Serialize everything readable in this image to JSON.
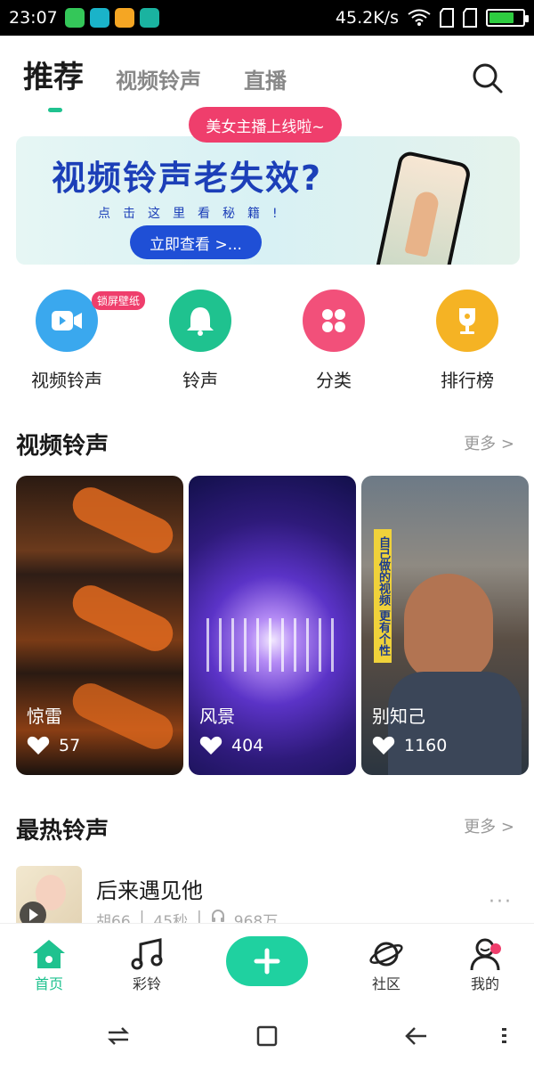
{
  "status": {
    "time": "23:07",
    "speed": "45.2K/s"
  },
  "tabs": [
    {
      "label": "推荐",
      "active": true
    },
    {
      "label": "视频铃声",
      "active": false
    },
    {
      "label": "直播",
      "active": false
    }
  ],
  "live_bubble": "美女主播上线啦~",
  "banner": {
    "title": "视频铃声老失效?",
    "subtitle": "点击这里看秘籍!",
    "button": "立即查看 >..."
  },
  "quick_links": [
    {
      "label": "视频铃声",
      "icon": "video-icon",
      "color": "#3aa8ee",
      "tag": "锁屏壁纸"
    },
    {
      "label": "铃声",
      "icon": "bell-icon",
      "color": "#1fc28f"
    },
    {
      "label": "分类",
      "icon": "category-icon",
      "color": "#f2507a"
    },
    {
      "label": "排行榜",
      "icon": "trophy-icon",
      "color": "#f5b324"
    }
  ],
  "video_section": {
    "title": "视频铃声",
    "more": "更多 >"
  },
  "videos": [
    {
      "name": "惊雷",
      "likes": "57"
    },
    {
      "name": "风景",
      "likes": "404"
    },
    {
      "name": "别知己",
      "likes": "1160"
    }
  ],
  "video3_overlay": "自己做的视频 更有个性",
  "hot_section": {
    "title": "最热铃声",
    "more": "更多 >"
  },
  "songs": [
    {
      "title": "后来遇见他",
      "artist": "胡66",
      "duration": "45秒",
      "plays": "968万"
    }
  ],
  "bottom_nav": [
    {
      "label": "首页",
      "icon": "home-icon",
      "active": true
    },
    {
      "label": "彩铃",
      "icon": "music-note-icon",
      "active": false
    },
    {
      "label": "",
      "icon": "plus-icon",
      "active": false
    },
    {
      "label": "社区",
      "icon": "planet-icon",
      "active": false
    },
    {
      "label": "我的",
      "icon": "profile-icon",
      "active": false
    }
  ],
  "colors": {
    "accent": "#1fc28f",
    "pink": "#ef3e6c",
    "banner_blue": "#1c3fb8"
  }
}
